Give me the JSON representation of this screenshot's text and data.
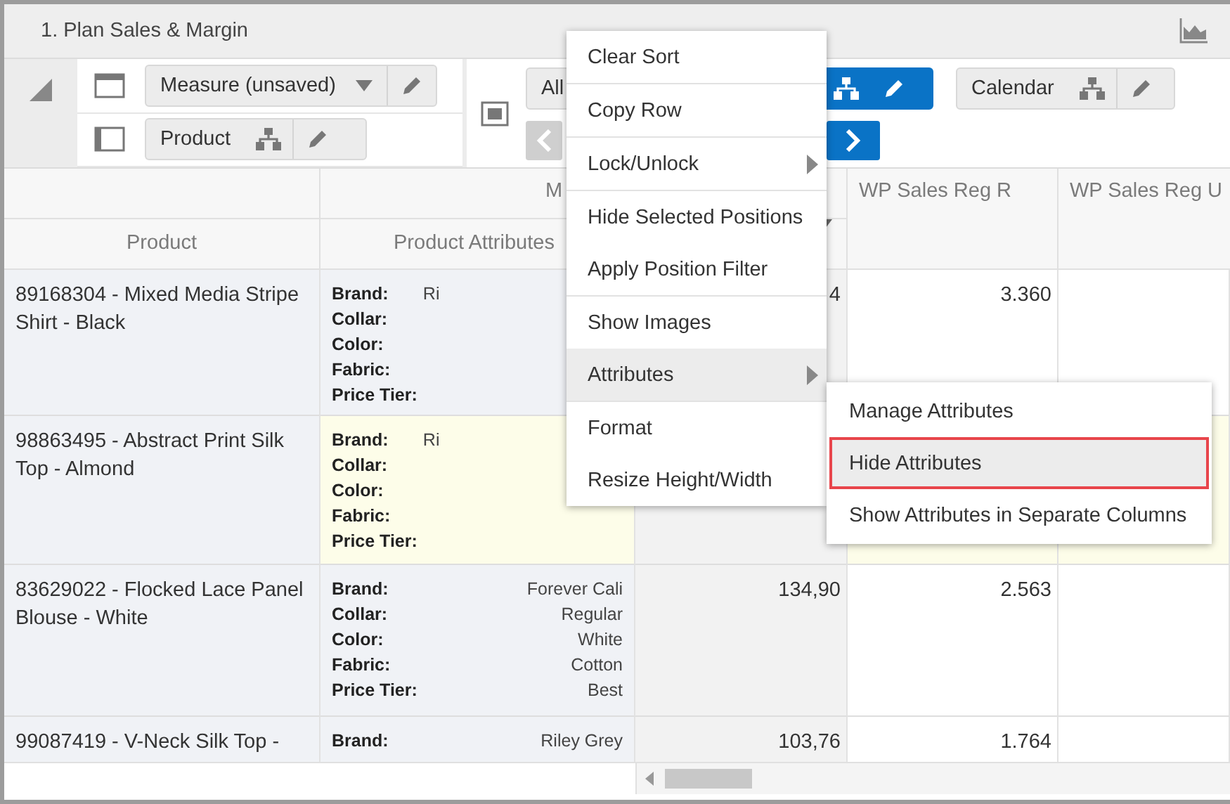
{
  "panel": {
    "title": "1. Plan Sales & Margin"
  },
  "toolbar": {
    "left": [
      {
        "label": "Measure (unsaved)",
        "kind": "dropdown"
      },
      {
        "label": "Product",
        "kind": "hierarchy"
      }
    ],
    "top": [
      {
        "label": "All",
        "kind": "dropdown",
        "active": false
      },
      {
        "kind": "hierarchy",
        "active": true
      },
      {
        "label": "Calendar",
        "kind": "hierarchy",
        "active": false
      }
    ],
    "bottom": [
      {
        "kind": "prev",
        "active": false
      },
      {
        "kind": "next",
        "active": true
      }
    ]
  },
  "table": {
    "group_header": "M",
    "columns": [
      "Product",
      "Product Attributes",
      "WP Sales Reg R",
      "WP Sales Reg U"
    ],
    "rows": [
      {
        "product": "89168304 - Mixed Media Stripe Shirt - Black",
        "highlighted": false,
        "covered": true,
        "attributes": [
          {
            "label": "Brand:",
            "value": "Ri"
          },
          {
            "label": "Collar:"
          },
          {
            "label": "Color:"
          },
          {
            "label": "Fabric:"
          },
          {
            "label": "Price Tier:"
          }
        ],
        "values": [
          "4",
          "3.360"
        ]
      },
      {
        "product": "98863495 - Abstract Print Silk Top - Almond",
        "highlighted": true,
        "covered": true,
        "attributes": [
          {
            "label": "Brand:",
            "value": "Ri"
          },
          {
            "label": "Collar:"
          },
          {
            "label": "Color:"
          },
          {
            "label": "Fabric:"
          },
          {
            "label": "Price Tier:"
          }
        ]
      },
      {
        "product": "83629022 - Flocked Lace Panel Blouse - White",
        "highlighted": false,
        "covered": false,
        "attributes": [
          {
            "label": "Brand:",
            "value": "Forever Cali"
          },
          {
            "label": "Collar:",
            "value": "Regular"
          },
          {
            "label": "Color:",
            "value": "White"
          },
          {
            "label": "Fabric:",
            "value": "Cotton"
          },
          {
            "label": "Price Tier:",
            "value": "Best"
          }
        ],
        "values": [
          "134,90",
          "2.563"
        ]
      },
      {
        "product": "99087419 - V-Neck Silk Top -",
        "highlighted": false,
        "covered": false,
        "attributes": [
          {
            "label": "Brand:",
            "value": "Riley Grey"
          }
        ],
        "values": [
          "103,76",
          "1.764"
        ]
      }
    ]
  },
  "context_menu": {
    "groups": [
      [
        {
          "label": "Clear Sort",
          "submenu": false,
          "selected": false
        }
      ],
      [
        {
          "label": "Copy Row",
          "submenu": false,
          "selected": false
        }
      ],
      [
        {
          "label": "Lock/Unlock",
          "submenu": true,
          "selected": false
        }
      ],
      [
        {
          "label": "Hide Selected Positions",
          "submenu": false,
          "selected": false
        },
        {
          "label": "Apply Position Filter",
          "submenu": false,
          "selected": false
        }
      ],
      [
        {
          "label": "Show Images",
          "submenu": false,
          "selected": false
        },
        {
          "label": "Attributes",
          "submenu": true,
          "selected": true
        }
      ],
      [
        {
          "label": "Format",
          "submenu": false,
          "selected": false
        },
        {
          "label": "Resize Height/Width",
          "submenu": false,
          "selected": false
        }
      ]
    ]
  },
  "submenu": {
    "items": [
      {
        "label": "Manage Attributes",
        "selected": false
      },
      {
        "label": "Hide Attributes",
        "selected": true
      },
      {
        "label": "Show Attributes in Separate Columns",
        "selected": false
      }
    ]
  }
}
